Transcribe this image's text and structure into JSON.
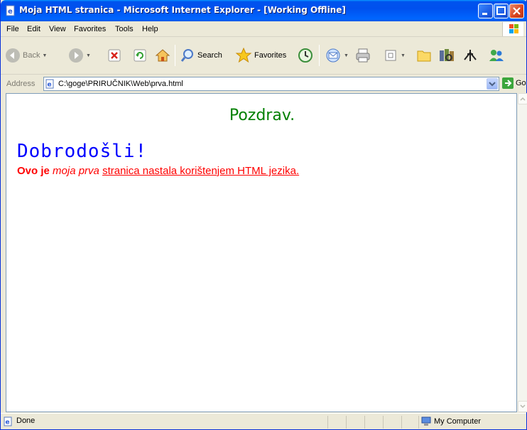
{
  "window": {
    "title": "Moja HTML stranica - Microsoft Internet Explorer - [Working Offline]"
  },
  "menu": {
    "items": [
      "File",
      "Edit",
      "View",
      "Favorites",
      "Tools",
      "Help"
    ]
  },
  "toolbar": {
    "back_label": "Back",
    "search_label": "Search",
    "favorites_label": "Favorites",
    "icons": [
      "back-icon",
      "forward-icon",
      "stop-icon",
      "refresh-icon",
      "home-icon",
      "search-icon",
      "favorites-star-icon",
      "history-icon",
      "mail-icon",
      "print-icon",
      "edit-icon",
      "folder-icon",
      "research-icon",
      "messenger-icon",
      "contacts-icon"
    ]
  },
  "address": {
    "label": "Address",
    "value": "C:\\goge\\PRIRUČNIK\\Web\\prva.html",
    "go_label": "Go"
  },
  "page": {
    "heading": "Pozdrav.",
    "welcome": "Dobrodošli!",
    "para_bold": "Ovo je",
    "para_italic": "moja prva",
    "para_underline": "stranica nastala korištenjem HTML jezika.",
    "colors": {
      "heading": "#008000",
      "welcome": "#0000ff",
      "paragraph": "#ff0000"
    }
  },
  "status": {
    "text": "Done",
    "zone": "My Computer"
  }
}
